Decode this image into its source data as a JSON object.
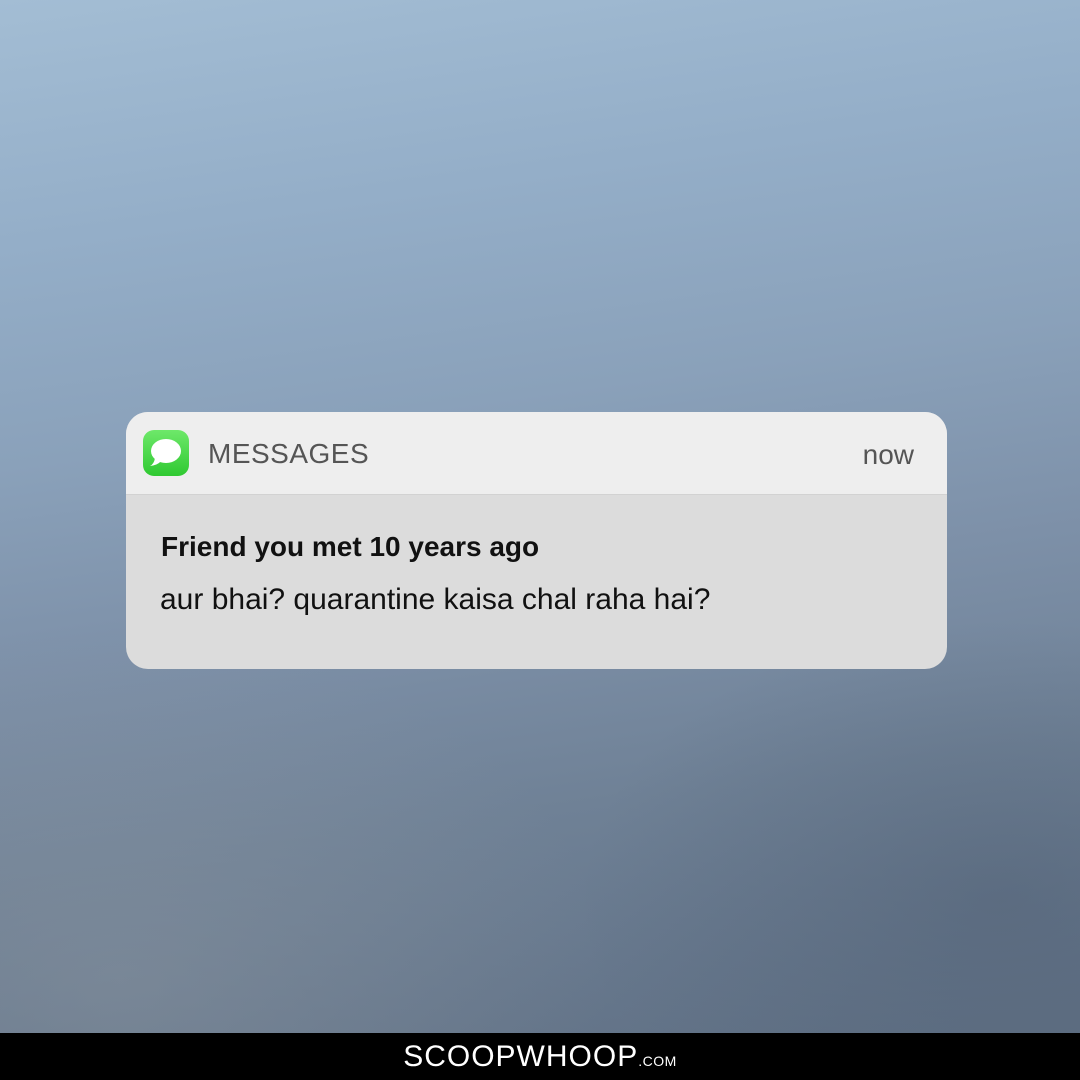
{
  "notification": {
    "app_name": "MESSAGES",
    "app_icon": "messages-bubble-icon",
    "timestamp": "now",
    "sender": "Friend you met 10 years ago",
    "message": "aur bhai? quarantine kaisa chal raha hai?"
  },
  "footer": {
    "brand": "SCOOPWHOOP",
    "brand_suffix": ".COM"
  },
  "colors": {
    "icon_green": "#34c934",
    "header_bg": "#eeeeee",
    "body_bg": "#dcdcdc",
    "footer_bg": "#000000"
  }
}
